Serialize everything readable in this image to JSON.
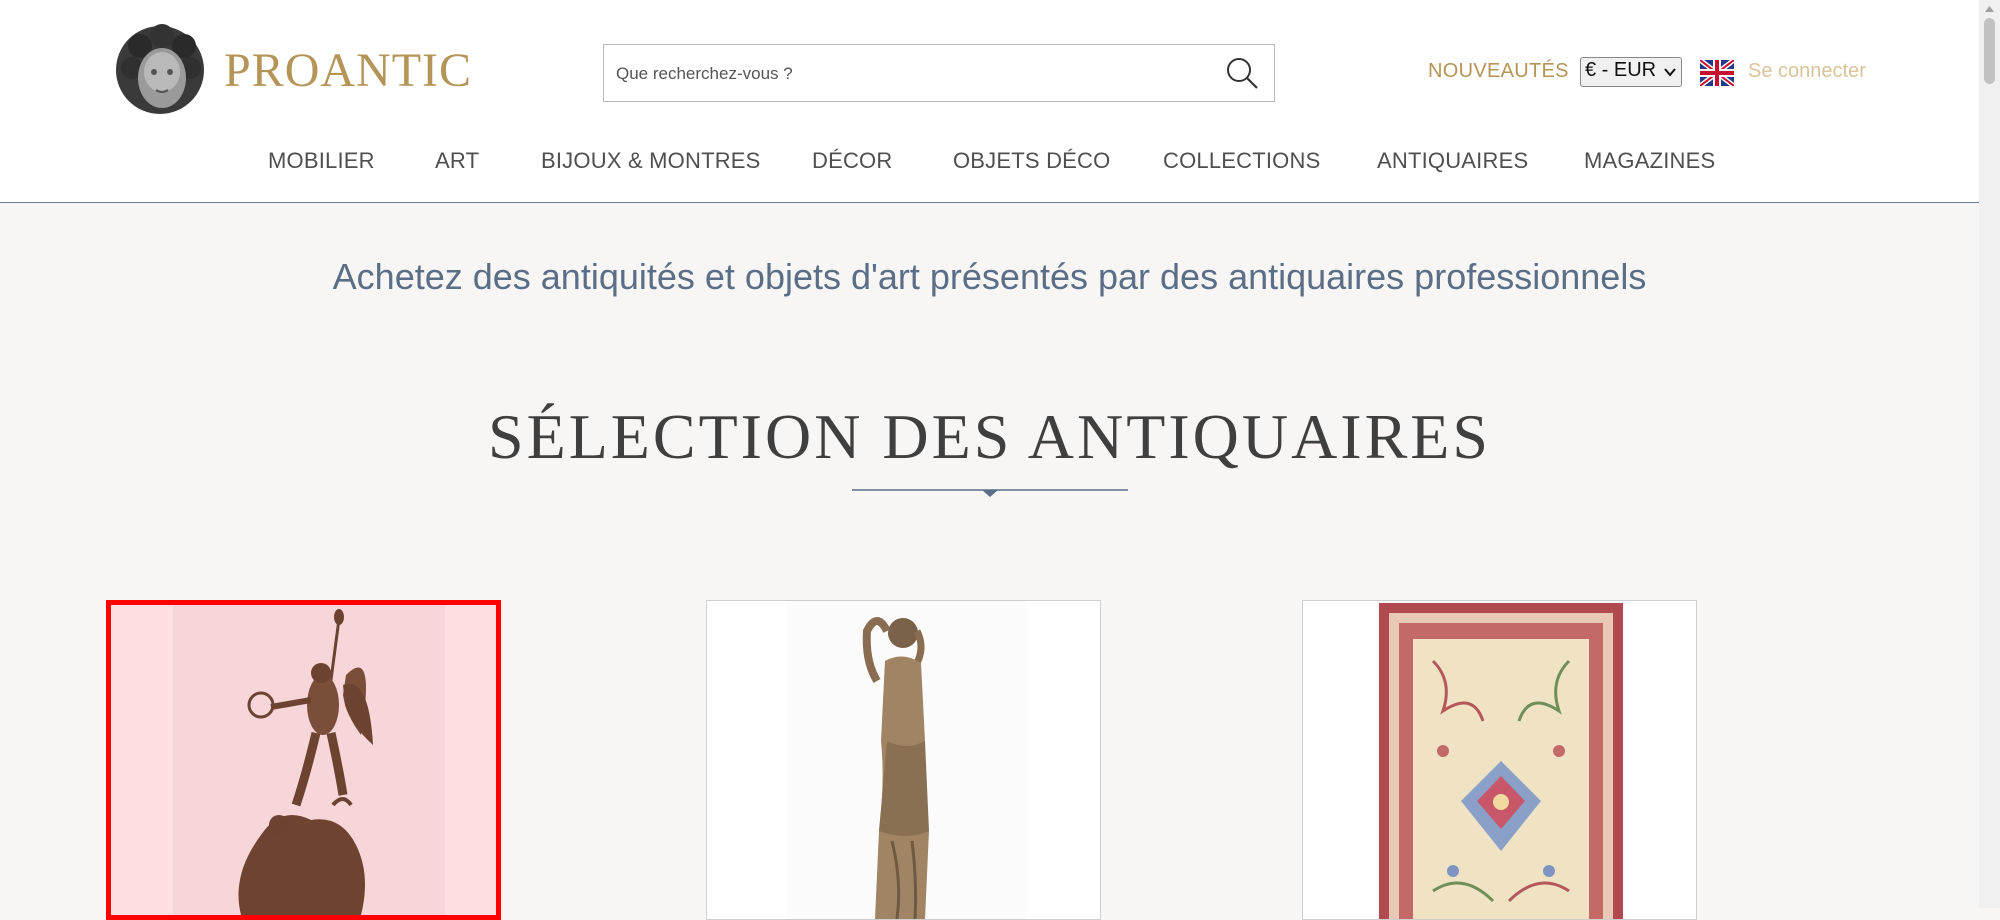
{
  "brand": {
    "name": "PROANTIC"
  },
  "search": {
    "placeholder": "Que recherchez-vous ?"
  },
  "header": {
    "new_label": "NOUVEAUTÉS",
    "currency": "€ - EUR",
    "login_label": "Se connecter",
    "flag_icon": "uk-flag-icon"
  },
  "nav": {
    "items": [
      {
        "label": "MOBILIER"
      },
      {
        "label": "ART"
      },
      {
        "label": "BIJOUX & MONTRES"
      },
      {
        "label": "DÉCOR"
      },
      {
        "label": "OBJETS DÉCO"
      },
      {
        "label": "COLLECTIONS"
      },
      {
        "label": "ANTIQUAIRES"
      },
      {
        "label": "MAGAZINES"
      }
    ]
  },
  "tagline": "Achetez des antiquités et objets d'art présentés par des antiquaires professionnels",
  "section": {
    "title": "SÉLECTION DES ANTIQUAIRES"
  },
  "colors": {
    "gold": "#b59457",
    "slate": "#5a6e87",
    "selection": "#ff0000"
  },
  "cards": [
    {
      "image": "bronze-winged-victory-sculpture",
      "selected": true
    },
    {
      "image": "bronze-female-statue",
      "selected": false
    },
    {
      "image": "persian-rug",
      "selected": false
    }
  ]
}
